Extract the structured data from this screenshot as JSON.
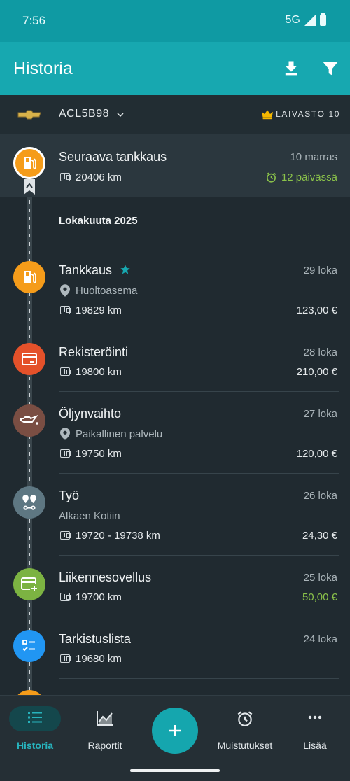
{
  "status_bar": {
    "time": "7:56",
    "network": "5G"
  },
  "app_bar": {
    "title": "Historia",
    "icons": [
      "download-icon",
      "filter-icon"
    ]
  },
  "vehicle": {
    "brand": "chevrolet-logo",
    "plate": "ACL5B98",
    "fleet_label": "LAIVASTO 10"
  },
  "next_refuel": {
    "title": "Seuraava tankkaus",
    "date": "10 marras",
    "odometer": "20406 km",
    "countdown": "12 päivässä",
    "icon": "fuel-pump-icon",
    "color": "#f59c1a"
  },
  "month_header": "Lokakuuta 2025",
  "entries": [
    {
      "title": "Tankkaus",
      "date": "29 loka",
      "location": "Huoltoasema",
      "odometer": "19829 km",
      "cost": "123,00 €",
      "icon": "fuel-pump-icon",
      "color": "#f59c1a",
      "starred": true
    },
    {
      "title": "Rekisteröinti",
      "date": "28 loka",
      "odometer": "19800 km",
      "cost": "210,00 €",
      "icon": "card-icon",
      "color": "#e4512a"
    },
    {
      "title": "Öljynvaihto",
      "date": "27 loka",
      "location": "Paikallinen palvelu",
      "odometer": "19750 km",
      "cost": "120,00 €",
      "icon": "oil-can-icon",
      "color": "#7a4e43"
    },
    {
      "title": "Työ",
      "date": "26 loka",
      "subtitle": "Alkaen Kotiin",
      "odometer": "19720 - 19738 km",
      "cost": "24,30 €",
      "icon": "route-icon",
      "color": "#5e7782"
    },
    {
      "title": "Liikennesovellus",
      "date": "25 loka",
      "odometer": "19700 km",
      "cost": "50,00 €",
      "icon": "card-add-icon",
      "color": "#7cb342",
      "cost_color": "#8bc34a"
    },
    {
      "title": "Tarkistuslista",
      "date": "24 loka",
      "odometer": "19680 km",
      "icon": "checklist-icon",
      "color": "#2196f3"
    }
  ],
  "bottom_nav": {
    "items": [
      {
        "label": "Historia",
        "icon": "list-icon",
        "active": true
      },
      {
        "label": "Raportit",
        "icon": "chart-icon"
      },
      {
        "label": "Muistutukset",
        "icon": "alarm-icon"
      },
      {
        "label": "Lisää",
        "icon": "more-icon"
      }
    ],
    "fab_icon": "plus-icon"
  }
}
